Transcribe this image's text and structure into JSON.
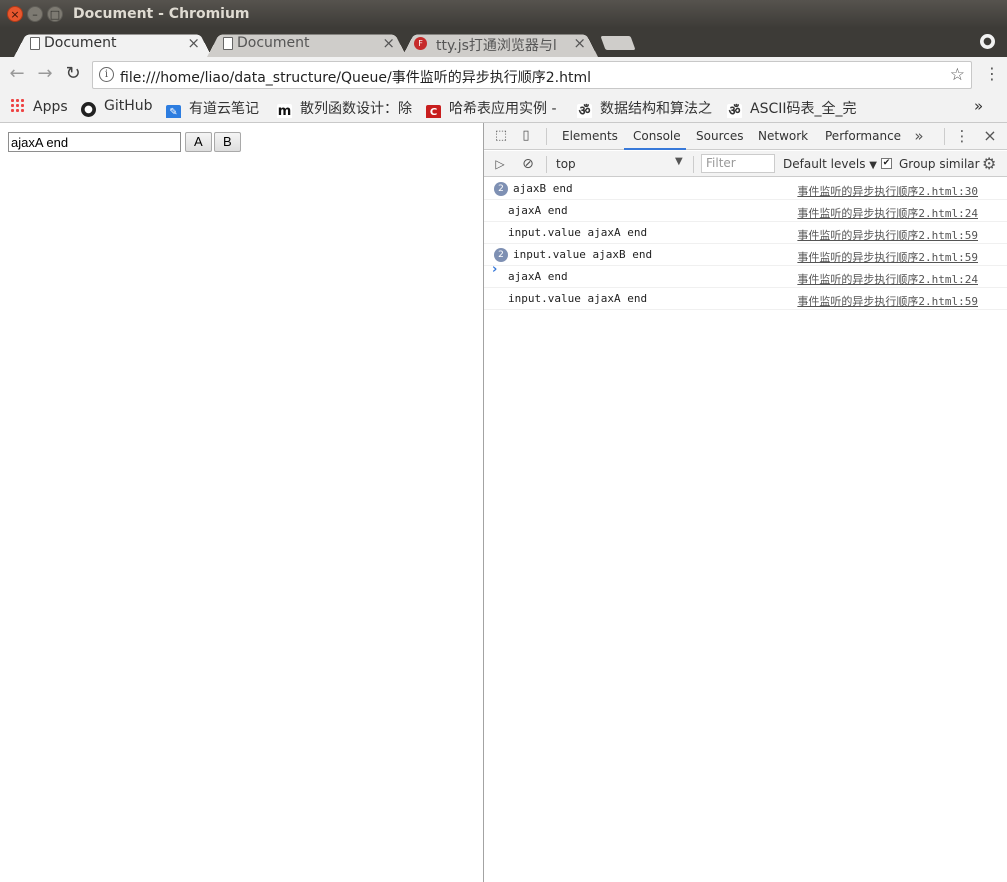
{
  "window": {
    "title": "Document - Chromium"
  },
  "tabs": [
    {
      "label": "Document"
    },
    {
      "label": "Document"
    },
    {
      "label": "tty.js打通浏览器与l"
    }
  ],
  "toolbar": {
    "url": "file:///home/liao/data_structure/Queue/事件监听的异步执行顺序2.html"
  },
  "bookmarks": [
    {
      "label": "Apps"
    },
    {
      "label": "GitHub"
    },
    {
      "label": "有道云笔记"
    },
    {
      "label": "散列函数设计：除"
    },
    {
      "label": "哈希表应用实例 -"
    },
    {
      "label": "数据结构和算法之"
    },
    {
      "label": "ASCII码表_全_完"
    }
  ],
  "page": {
    "input_value": "ajaxA end",
    "button_a": "A",
    "button_b": "B"
  },
  "devtools": {
    "tabs": [
      "Elements",
      "Console",
      "Sources",
      "Network",
      "Performance"
    ],
    "active_tab": "Console",
    "context": "top",
    "filter_placeholder": "Filter",
    "levels": "Default levels",
    "group_similar": "Group similar",
    "group_similar_checked": true,
    "messages": [
      {
        "count": "2",
        "text": "ajaxB end",
        "source": "事件监听的异步执行顺序2.html:30"
      },
      {
        "count": "",
        "text": "ajaxA end",
        "source": "事件监听的异步执行顺序2.html:24"
      },
      {
        "count": "",
        "text": "input.value ajaxA end",
        "source": "事件监听的异步执行顺序2.html:59"
      },
      {
        "count": "2",
        "text": "input.value ajaxB end",
        "source": "事件监听的异步执行顺序2.html:59"
      },
      {
        "count": "",
        "text": "ajaxA end",
        "source": "事件监听的异步执行顺序2.html:24"
      },
      {
        "count": "",
        "text": "input.value ajaxA end",
        "source": "事件监听的异步执行顺序2.html:59"
      }
    ]
  }
}
